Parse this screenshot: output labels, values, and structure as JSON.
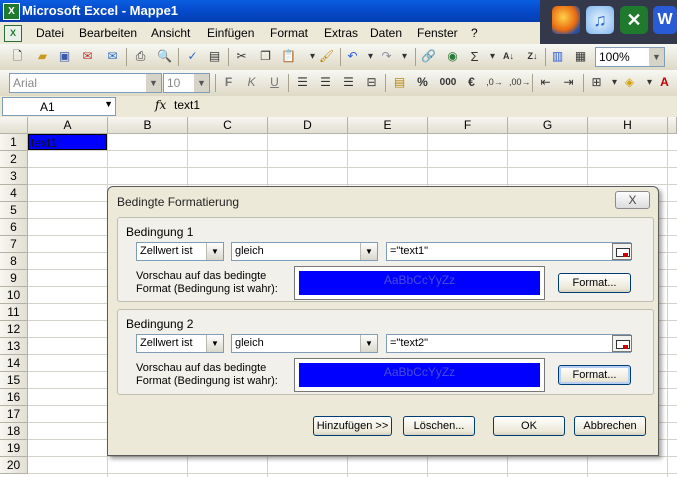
{
  "window": {
    "title": "Microsoft Excel - Mappe1",
    "app_icon": "X"
  },
  "taskbar_icons": [
    "firefox-icon",
    "itunes-icon",
    "excel-icon",
    "word-icon"
  ],
  "menu": [
    {
      "label": "Datei"
    },
    {
      "label": "Bearbeiten"
    },
    {
      "label": "Ansicht"
    },
    {
      "label": "Einfügen"
    },
    {
      "label": "Format"
    },
    {
      "label": "Extras"
    },
    {
      "label": "Daten"
    },
    {
      "label": "Fenster"
    },
    {
      "label": "?"
    }
  ],
  "toolbar": {
    "zoom": "100%",
    "font_name": "Arial",
    "font_size": "10",
    "bold": "F",
    "italic": "K",
    "underline": "U",
    "percent": "%",
    "thousands": "000",
    "euro": "€",
    "sum": "Σ"
  },
  "formula_bar": {
    "name_box": "A1",
    "fx": "fx",
    "content": "text1"
  },
  "sheet": {
    "columns": [
      "A",
      "B",
      "C",
      "D",
      "E",
      "F",
      "G",
      "H"
    ],
    "rows": [
      "1",
      "2",
      "3",
      "4",
      "5",
      "6",
      "7",
      "8",
      "9",
      "10",
      "11",
      "12",
      "13",
      "14",
      "15",
      "16",
      "17",
      "18",
      "19",
      "20"
    ],
    "cell_a1": "text1",
    "highlight_color": "#0000ff"
  },
  "dialog": {
    "title": "Bedingte Formatierung",
    "close": "X",
    "conditions": [
      {
        "label": "Bedingung 1",
        "type": "Zellwert ist",
        "operator": "gleich",
        "value": "=\"text1\"",
        "preview_desc_1": "Vorschau auf das bedingte",
        "preview_desc_2": "Format (Bedingung ist wahr):",
        "preview_text": "AaBbCcYyZz",
        "format_button": "Format..."
      },
      {
        "label": "Bedingung 2",
        "type": "Zellwert ist",
        "operator": "gleich",
        "value": "=\"text2\"",
        "preview_desc_1": "Vorschau auf das bedingte",
        "preview_desc_2": "Format (Bedingung ist wahr):",
        "preview_text": "AaBbCcYyZz",
        "format_button": "Format..."
      }
    ],
    "buttons": {
      "add": "Hinzufügen >>",
      "delete": "Löschen...",
      "ok": "OK",
      "cancel": "Abbrechen"
    }
  }
}
